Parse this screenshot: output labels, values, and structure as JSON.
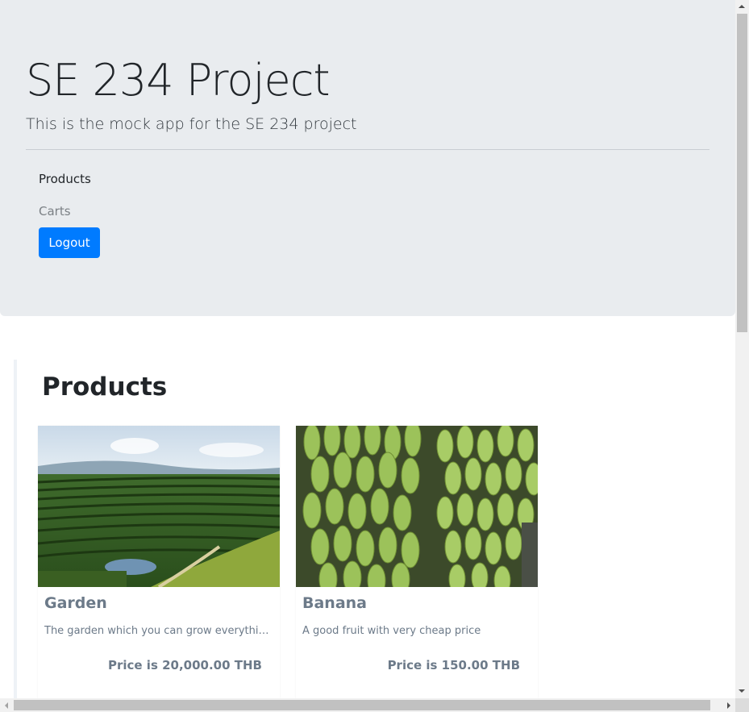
{
  "header": {
    "title": "SE 234 Project",
    "subtitle": "This is the mock app for the SE 234 project"
  },
  "nav": {
    "items": [
      {
        "label": "Products",
        "active": true
      },
      {
        "label": "Carts",
        "active": false
      }
    ],
    "logout_label": "Logout"
  },
  "main": {
    "section_title": "Products",
    "products": [
      {
        "name": "Garden",
        "description": "The garden which you can grow everything on earth",
        "price": "Price is 20,000.00 THB",
        "image_icon": "garden-photo"
      },
      {
        "name": "Banana",
        "description": "A good fruit with very cheap price",
        "price": "Price is 150.00 THB",
        "image_icon": "banana-photo"
      }
    ]
  },
  "colors": {
    "accent": "#007bff",
    "jumbotron_bg": "#e9ecef",
    "card_text": "#6c7a89"
  }
}
